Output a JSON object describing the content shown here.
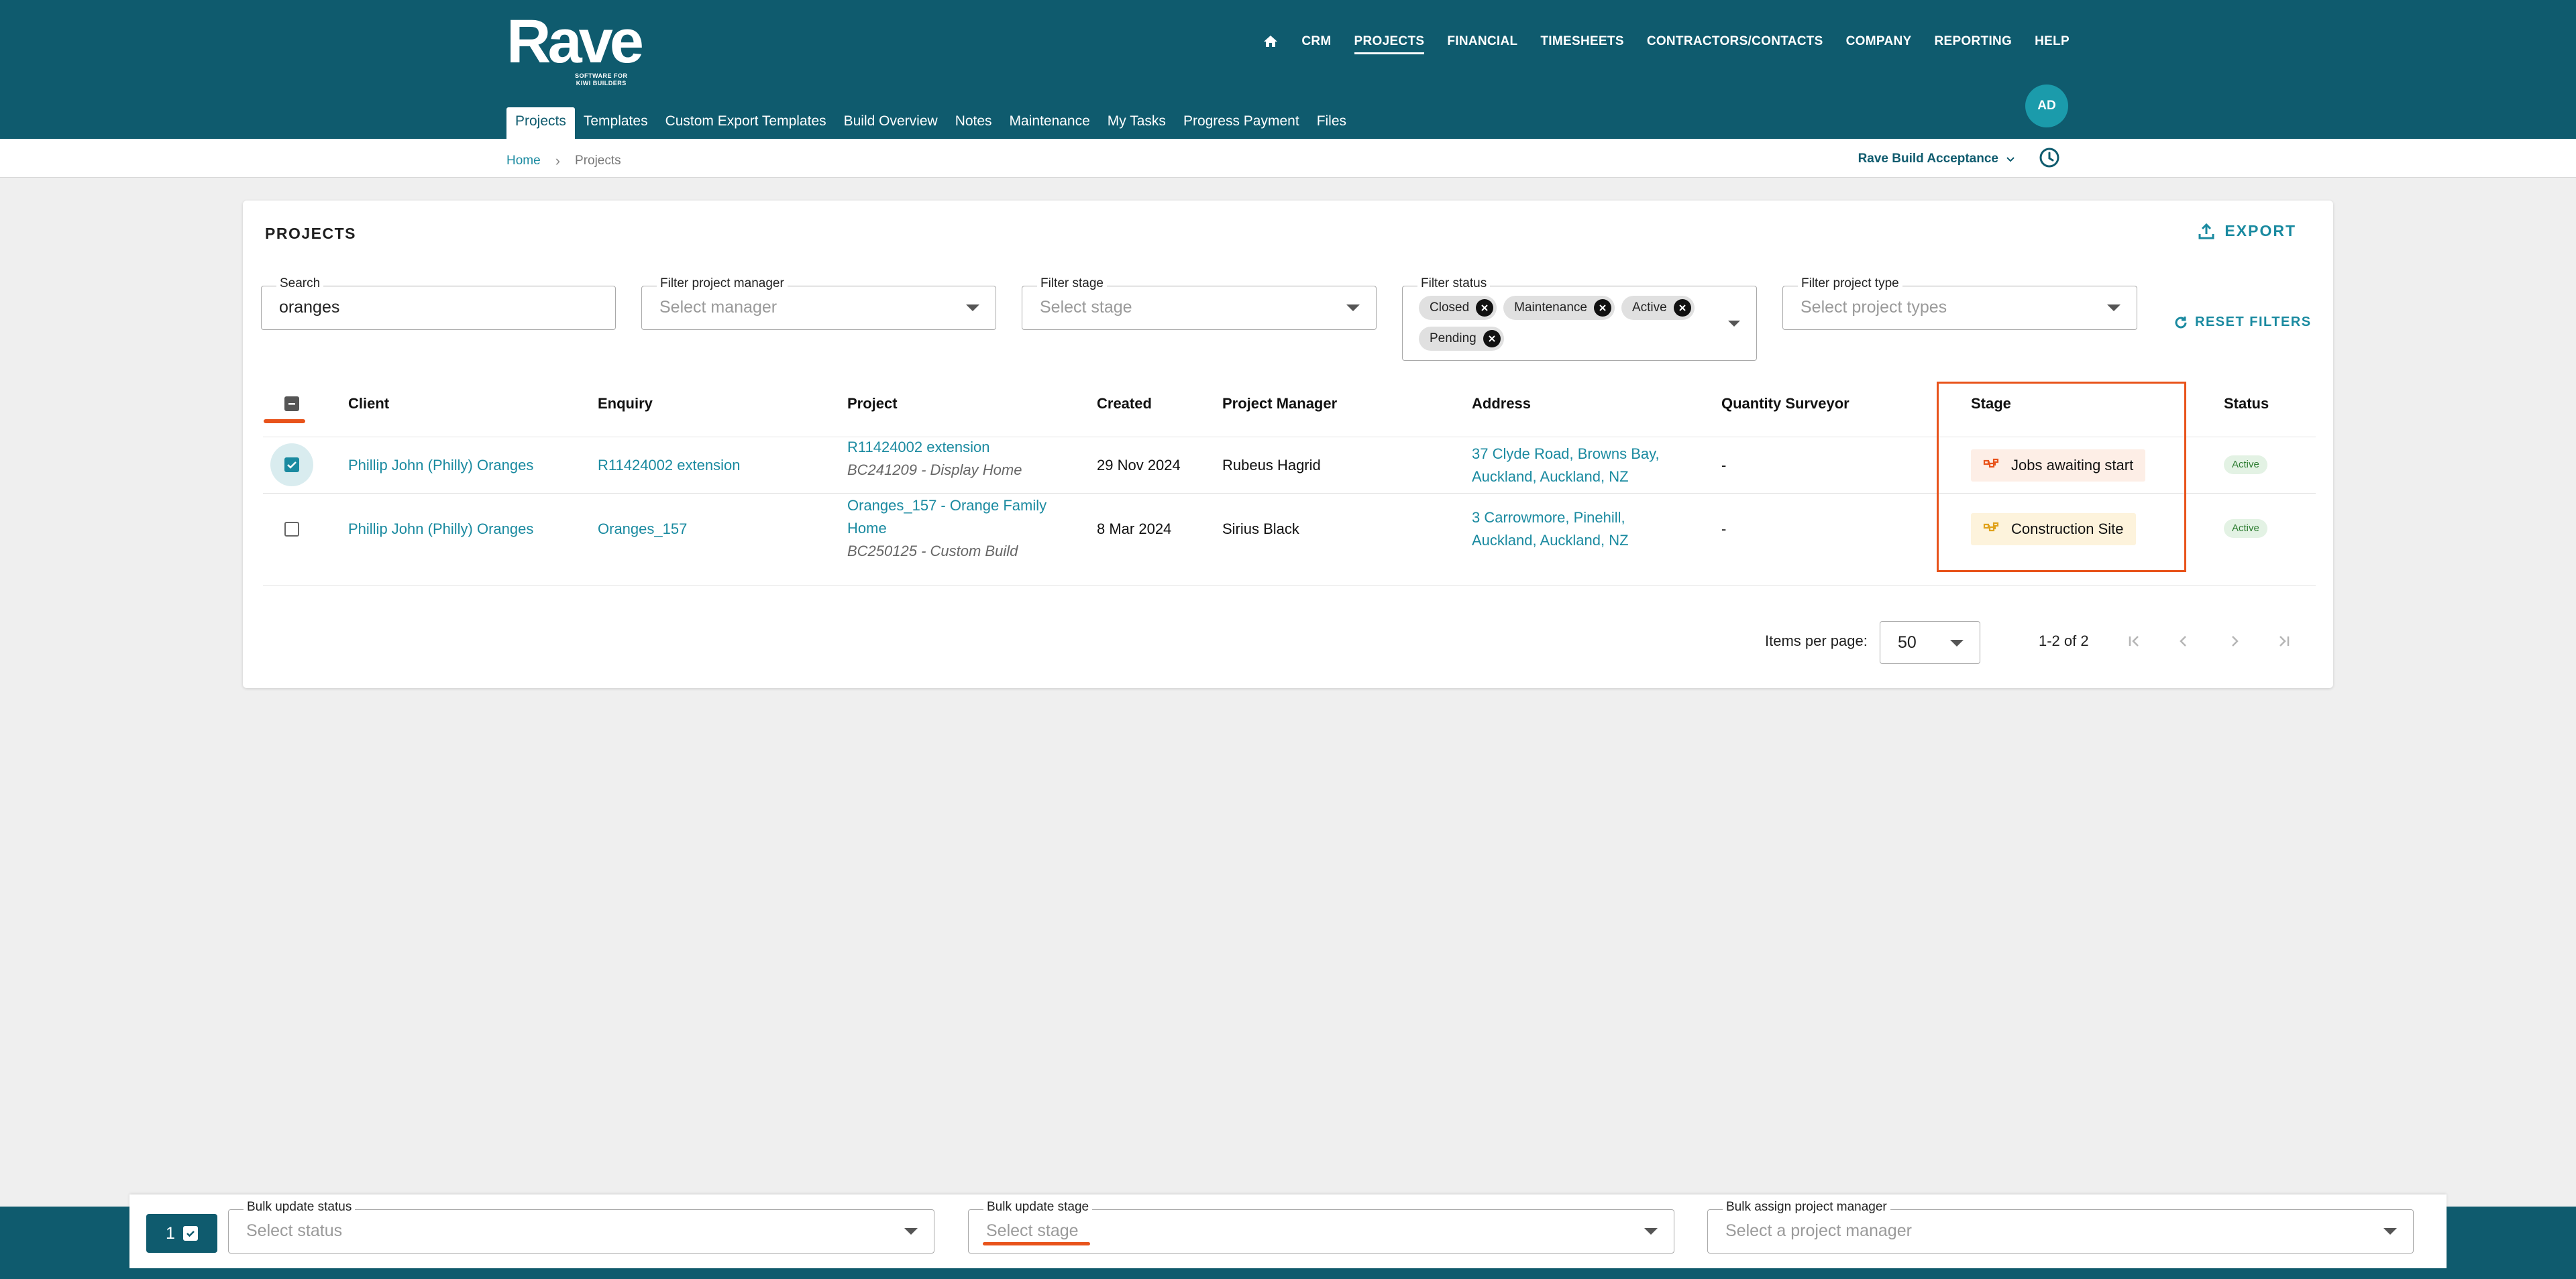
{
  "brand": {
    "name": "Rave",
    "tagline_line1": "SOFTWARE FOR",
    "tagline_line2": "KIWI BUILDERS"
  },
  "topnav": [
    "CRM",
    "PROJECTS",
    "FINANCIAL",
    "TIMESHEETS",
    "CONTRACTORS/CONTACTS",
    "COMPANY",
    "REPORTING",
    "HELP"
  ],
  "subnav": [
    "Projects",
    "Templates",
    "Custom Export Templates",
    "Build Overview",
    "Notes",
    "Maintenance",
    "My Tasks",
    "Progress Payment",
    "Files"
  ],
  "avatar": "AD",
  "breadcrumb": {
    "home": "Home",
    "current": "Projects",
    "separator": "›"
  },
  "org": "Rave Build Acceptance",
  "page": {
    "title": "PROJECTS",
    "export": "EXPORT",
    "reset": "RESET FILTERS"
  },
  "filters": {
    "search": {
      "label": "Search",
      "value": "oranges"
    },
    "manager": {
      "label": "Filter project manager",
      "placeholder": "Select manager"
    },
    "stage": {
      "label": "Filter stage",
      "placeholder": "Select stage"
    },
    "status": {
      "label": "Filter status",
      "chips": [
        "Closed",
        "Maintenance",
        "Active",
        "Pending"
      ]
    },
    "type": {
      "label": "Filter project type",
      "placeholder": "Select project types"
    }
  },
  "table": {
    "headers": [
      "Client",
      "Enquiry",
      "Project",
      "Created",
      "Project Manager",
      "Address",
      "Quantity Surveyor",
      "Stage",
      "Status"
    ],
    "rows": [
      {
        "client": "Phillip John (Philly) Oranges",
        "enquiry": "R11424002 extension",
        "project": "R11424002 extension",
        "project_sub": "BC241209 - Display Home",
        "created": "29 Nov 2024",
        "manager": "Rubeus Hagrid",
        "address1": "37 Clyde Road, Browns Bay,",
        "address2": "Auckland, Auckland, NZ",
        "qs": "-",
        "stage": "Jobs awaiting start",
        "status": "Active",
        "checked": true
      },
      {
        "client": "Phillip John (Philly) Oranges",
        "enquiry": "Oranges_157",
        "project1": "Oranges_157 - Orange Family",
        "project2": "Home",
        "project_sub": "BC250125 - Custom Build",
        "created": "8 Mar 2024",
        "manager": "Sirius Black",
        "address1": "3 Carrowmore, Pinehill,",
        "address2": "Auckland, Auckland, NZ",
        "qs": "-",
        "stage": "Construction Site",
        "status": "Active",
        "checked": false
      }
    ]
  },
  "pagination": {
    "label": "Items per page:",
    "per_page": "50",
    "range": "1-2 of 2"
  },
  "bulk": {
    "count": "1",
    "status": {
      "label": "Bulk update status",
      "placeholder": "Select status"
    },
    "stage": {
      "label": "Bulk update stage",
      "placeholder": "Select stage"
    },
    "manager": {
      "label": "Bulk assign project manager",
      "placeholder": "Select a project manager"
    }
  },
  "colors": {
    "brand": "#0f5b6e",
    "link": "#1a8aa0",
    "highlight": "#e8531b",
    "stage_orange_bg": "#fdeee6",
    "stage_yellow_bg": "#fdf3dc"
  }
}
